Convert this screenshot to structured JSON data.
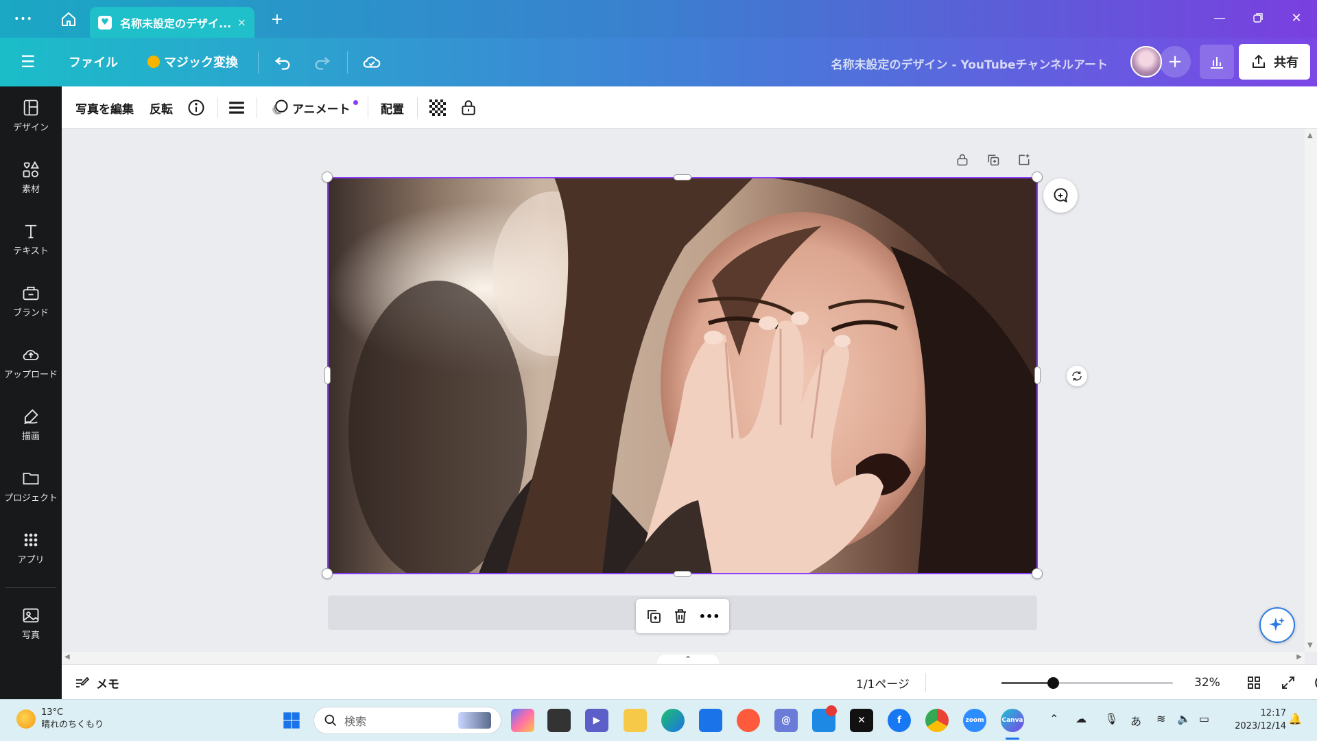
{
  "browser": {
    "tab_title": "名称未設定のデザイ...",
    "tab_close": "×",
    "new_tab": "+",
    "menu_dots": "•••"
  },
  "header": {
    "menu_icon": "☰",
    "file_label": "ファイル",
    "magic_label": "マジック変換",
    "doc_title": "名称未設定のデザイン - YouTubeチャンネルアート",
    "add_label": "+",
    "share_label": "共有"
  },
  "sidebar": {
    "items": [
      {
        "label": "デザイン"
      },
      {
        "label": "素材"
      },
      {
        "label": "テキスト"
      },
      {
        "label": "ブランド"
      },
      {
        "label": "アップロード"
      },
      {
        "label": "描画"
      },
      {
        "label": "プロジェクト"
      },
      {
        "label": "アプリ"
      },
      {
        "label": "写真"
      }
    ]
  },
  "toolbar": {
    "edit_photo": "写真を編集",
    "flip": "反転",
    "animate": "アニメート",
    "position": "配置"
  },
  "canvas": {
    "minibar_more": "•••",
    "collapse": "⌃"
  },
  "footer": {
    "notes": "メモ",
    "page_indicator": "1/1ページ",
    "zoom_level": "32%",
    "zoom_fraction": 0.3,
    "help": "?"
  },
  "taskbar": {
    "weather_temp": "13°C",
    "weather_desc": "晴れのちくもり",
    "search_placeholder": "検索",
    "time": "12:17",
    "date": "2023/12/14",
    "ime": "あ",
    "zoom_app": "zoom",
    "canva_app": "Canva"
  },
  "colors": {
    "selection": "#8b3dff",
    "sidebar_bg": "#18191b",
    "header_start": "#1bbdc9",
    "header_end": "#7b46e6"
  }
}
